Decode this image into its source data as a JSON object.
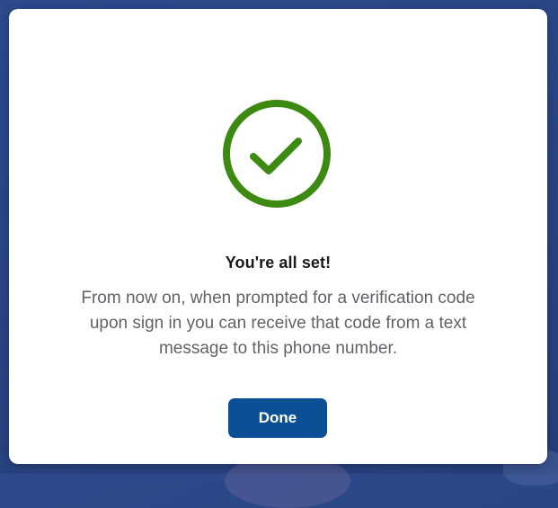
{
  "dialog": {
    "status_icon": "checkmark-circle-icon",
    "title": "You're all set!",
    "message": "From now on, when prompted for a verification code upon sign in you can receive that code from a text message to this phone number.",
    "done_label": "Done"
  },
  "colors": {
    "success": "#3d8a12",
    "button": "#0b4f94",
    "backdrop": "#2a4584",
    "message_text": "#5f6368"
  }
}
